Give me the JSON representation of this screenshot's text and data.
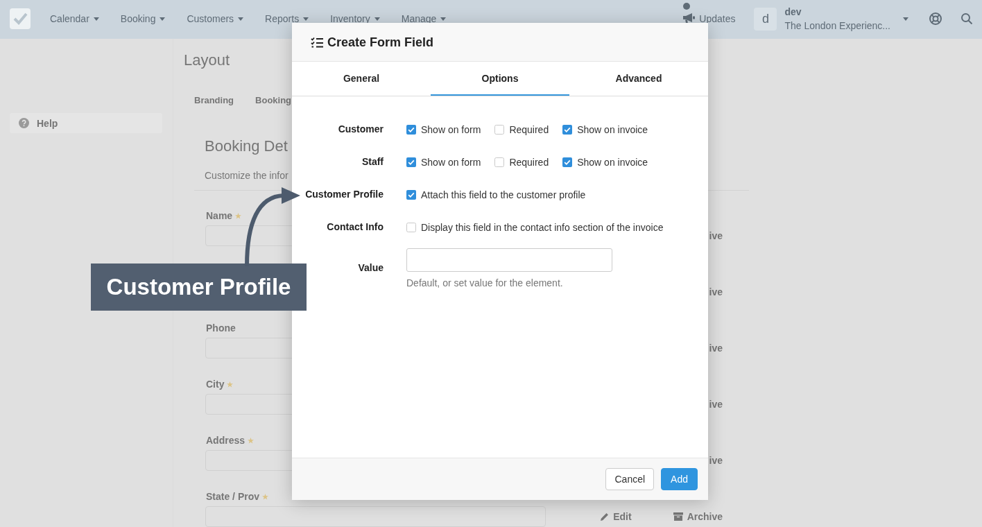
{
  "navbar": {
    "menu": [
      {
        "label": "Calendar"
      },
      {
        "label": "Booking"
      },
      {
        "label": "Customers"
      },
      {
        "label": "Reports"
      },
      {
        "label": "Inventory"
      },
      {
        "label": "Manage"
      }
    ],
    "updates": {
      "label": "Updates",
      "unread": true
    },
    "account": {
      "avatar": "d",
      "name": "dev",
      "business": "The London Experienc..."
    }
  },
  "sidebar": {
    "items": [
      {
        "label": "Help"
      }
    ]
  },
  "page": {
    "title": "Layout",
    "tabs": [
      {
        "label": "Branding"
      },
      {
        "label": "Booking"
      }
    ],
    "section": {
      "title": "Booking Det",
      "description": "Customize the infor",
      "fields": [
        {
          "label": "Name",
          "required": true,
          "actions": [
            {
              "kind": "partial",
              "label": "ive"
            }
          ]
        },
        {
          "actions": [
            {
              "kind": "partial",
              "label": "ive"
            }
          ]
        },
        {
          "label": "Phone",
          "required": false,
          "actions": [
            {
              "kind": "partial",
              "label": "ive"
            }
          ]
        },
        {
          "label": "City",
          "required": true,
          "actions": [
            {
              "kind": "partial",
              "label": "ive"
            }
          ]
        },
        {
          "label": "Address",
          "required": true,
          "actions": [
            {
              "kind": "partial",
              "label": "ive"
            }
          ]
        },
        {
          "label": "State / Prov",
          "required": true,
          "actions": [
            {
              "kind": "edit",
              "label": "Edit"
            },
            {
              "kind": "archive",
              "label": "Archive"
            }
          ]
        }
      ]
    }
  },
  "modal": {
    "title": "Create Form Field",
    "tabs": [
      {
        "label": "General",
        "selected": false
      },
      {
        "label": "Options",
        "selected": true
      },
      {
        "label": "Advanced",
        "selected": false
      }
    ],
    "rows": [
      {
        "label": "Customer",
        "kind": "checkboxes",
        "options": [
          {
            "label": "Show on form",
            "checked": true
          },
          {
            "label": "Required",
            "checked": false
          },
          {
            "label": "Show on invoice",
            "checked": true
          }
        ]
      },
      {
        "label": "Staff",
        "kind": "checkboxes",
        "options": [
          {
            "label": "Show on form",
            "checked": true
          },
          {
            "label": "Required",
            "checked": false
          },
          {
            "label": "Show on invoice",
            "checked": true
          }
        ]
      },
      {
        "label": "Customer Profile",
        "kind": "checkboxes",
        "options": [
          {
            "label": "Attach this field to the customer profile",
            "checked": true
          }
        ]
      },
      {
        "label": "Contact Info",
        "kind": "checkboxes",
        "options": [
          {
            "label": "Display this field in the contact info section of the invoice",
            "checked": false
          }
        ]
      },
      {
        "label": "Value",
        "kind": "text",
        "help": "Default, or set value for the element."
      }
    ],
    "buttons": [
      {
        "label": "Cancel",
        "kind": "secondary"
      },
      {
        "label": "Add",
        "kind": "primary"
      }
    ]
  },
  "callout": {
    "label": "Customer Profile"
  }
}
